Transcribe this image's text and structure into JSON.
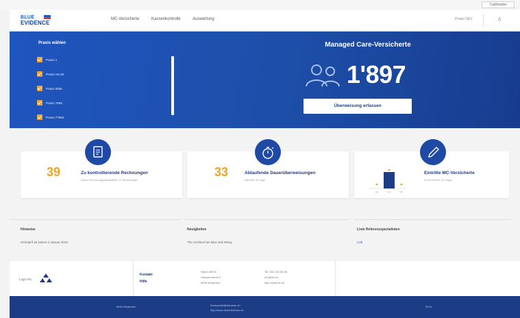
{
  "os": {
    "item": "Caldmaster"
  },
  "header": {
    "logo_line1": "BLUE",
    "logo_line2": "EVIDENCE",
    "nav": [
      "MC-Versicherte",
      "Kassenkontrolle",
      "Auswertung"
    ],
    "user": "Praxis DEV"
  },
  "hero": {
    "praxis_title": "Praxis wählen",
    "praxis_items": [
      "Praxis 1",
      "Praxis HCAB",
      "Praxis 5555",
      "Praxis 7889",
      "Praxis 77855"
    ],
    "mc_title": "Managed Care-Versicherte",
    "mc_count": "1'897",
    "button_label": "Überweisung erfassen"
  },
  "cards": [
    {
      "number": "39",
      "title": "Zu kontrollierende Rechnungen",
      "subtitle": "Davon Rechnungsplausibilität: 12 Rechnungen"
    },
    {
      "number": "33",
      "title": "Ablaufende Dauerüberweisungen",
      "subtitle": "Nächste 30 Tage"
    },
    {
      "number": "",
      "title": "Eintritte MC-Versicherte",
      "subtitle": "in den letzten 30 Tagen"
    }
  ],
  "mini_chart": {
    "type": "bar",
    "categories": [
      "Jan",
      "Feb",
      "Mar"
    ],
    "values": [
      2,
      16,
      2
    ],
    "colors": {
      "bar": "#1c3c86",
      "point": "#f2a21c"
    }
  },
  "info": {
    "col1_title": "Hinweise",
    "col1_text": "Heimtarif ab Datum 3 Januar 2019",
    "col2_title": "Neuigkeiten",
    "col2_text": "The Architect bei Blue and Weeg",
    "col3_title": "Liste Referenzspezialisten",
    "col3_link": "Link"
  },
  "contact": {
    "logo_label": "Logo HG",
    "link1": "Kontakt",
    "link2": "Hilfe",
    "address": [
      "Name ABCD",
      "Strassenname 5",
      "8000 Winterthur"
    ],
    "phones": [
      "Tel. 052 232 56 56",
      "Info@hx.ch",
      "http://www.hx.ch"
    ]
  },
  "footer": {
    "left": "8000 Winterthur",
    "middle1": "Ihrekontakt@ihrname.ch",
    "middle2": "http://www.blueevidence.ch",
    "right": "2019"
  },
  "colors": {
    "accent": "#1c3c86",
    "orange": "#f2a21c",
    "hero": "#1f55bf"
  }
}
